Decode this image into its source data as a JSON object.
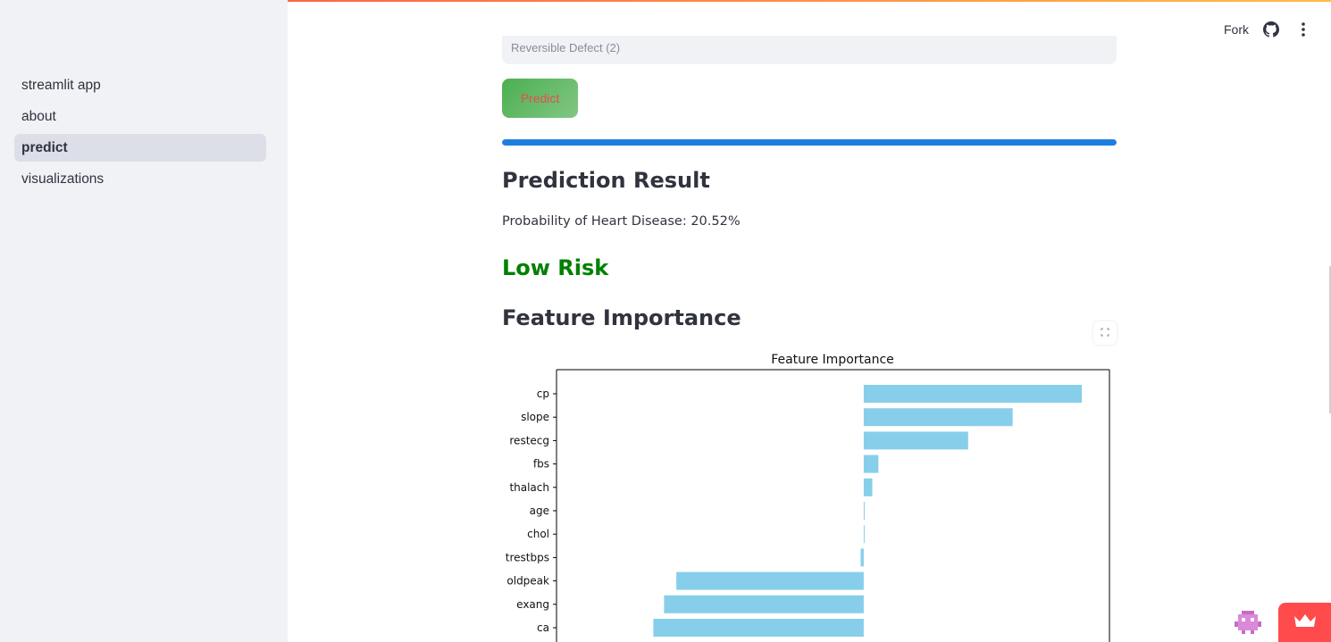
{
  "sidebar": {
    "items": [
      {
        "label": "streamlit app",
        "active": false
      },
      {
        "label": "about",
        "active": false
      },
      {
        "label": "predict",
        "active": true
      },
      {
        "label": "visualizations",
        "active": false
      }
    ]
  },
  "header": {
    "fork_label": "Fork",
    "github_icon": "github-icon",
    "menu_icon": "kebab-menu-icon"
  },
  "form": {
    "select_value": "Reversible Defect (2)",
    "predict_label": "Predict"
  },
  "progress": {
    "value_percent": 100
  },
  "result": {
    "heading": "Prediction Result",
    "probability_text": "Probability of Heart Disease: 20.52%",
    "risk_label": "Low Risk",
    "risk_color": "#008000"
  },
  "feature_section": {
    "heading": "Feature Importance"
  },
  "chart_data": {
    "type": "bar",
    "orientation": "horizontal",
    "title": "Feature Importance",
    "categories": [
      "cp",
      "slope",
      "restecg",
      "fbs",
      "thalach",
      "age",
      "chol",
      "trestbps",
      "oldpeak",
      "exang",
      "ca"
    ],
    "values": [
      0.71,
      0.485,
      0.34,
      0.048,
      0.028,
      0.003,
      0.001,
      -0.01,
      -0.61,
      -0.65,
      -0.685
    ],
    "xlim": [
      -1.0,
      0.8
    ],
    "bar_color": "#87ceeb"
  }
}
